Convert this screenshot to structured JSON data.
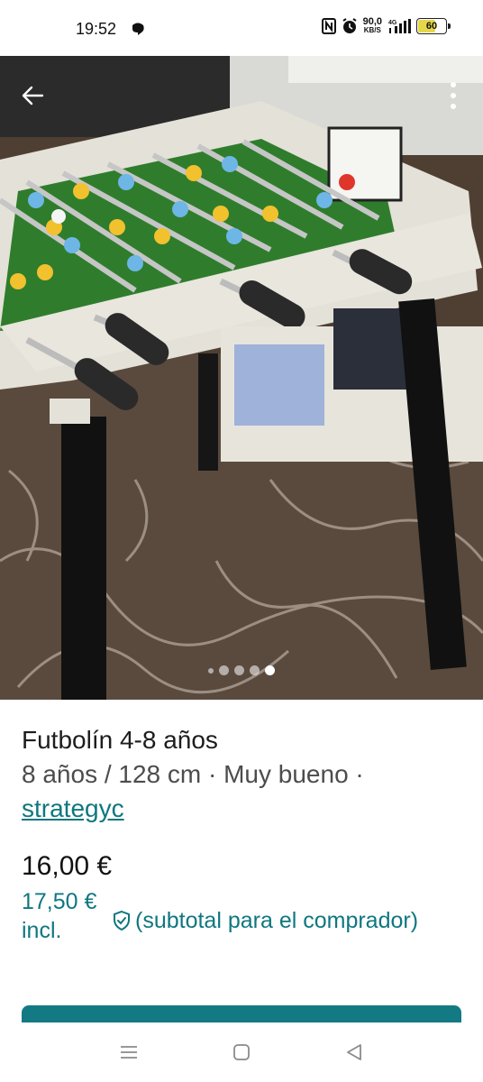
{
  "status_bar": {
    "time": "19:52",
    "net_speed_value": "90,0",
    "net_speed_unit": "KB/S",
    "network_type": "4G",
    "battery_level": "60",
    "battery_fraction": 0.6,
    "battery_color": "#e6d74a"
  },
  "photo": {
    "icons": {
      "back": "arrow-left-icon",
      "more": "more-vertical-icon"
    },
    "carousel": {
      "count": 5,
      "active_index": 4
    }
  },
  "listing": {
    "title": "Futbolín 4-8 años",
    "subtitle": "8 años / 128 cm · Muy bueno ·",
    "seller": "strategyc",
    "price": "16,00 €",
    "price_incl": "17,50 € incl.",
    "buyer_note": "(subtotal para el comprador)",
    "accent_color": "#0f7780"
  },
  "nav": {
    "icons": [
      "menu-icon",
      "home-square-icon",
      "back-triangle-icon"
    ]
  }
}
